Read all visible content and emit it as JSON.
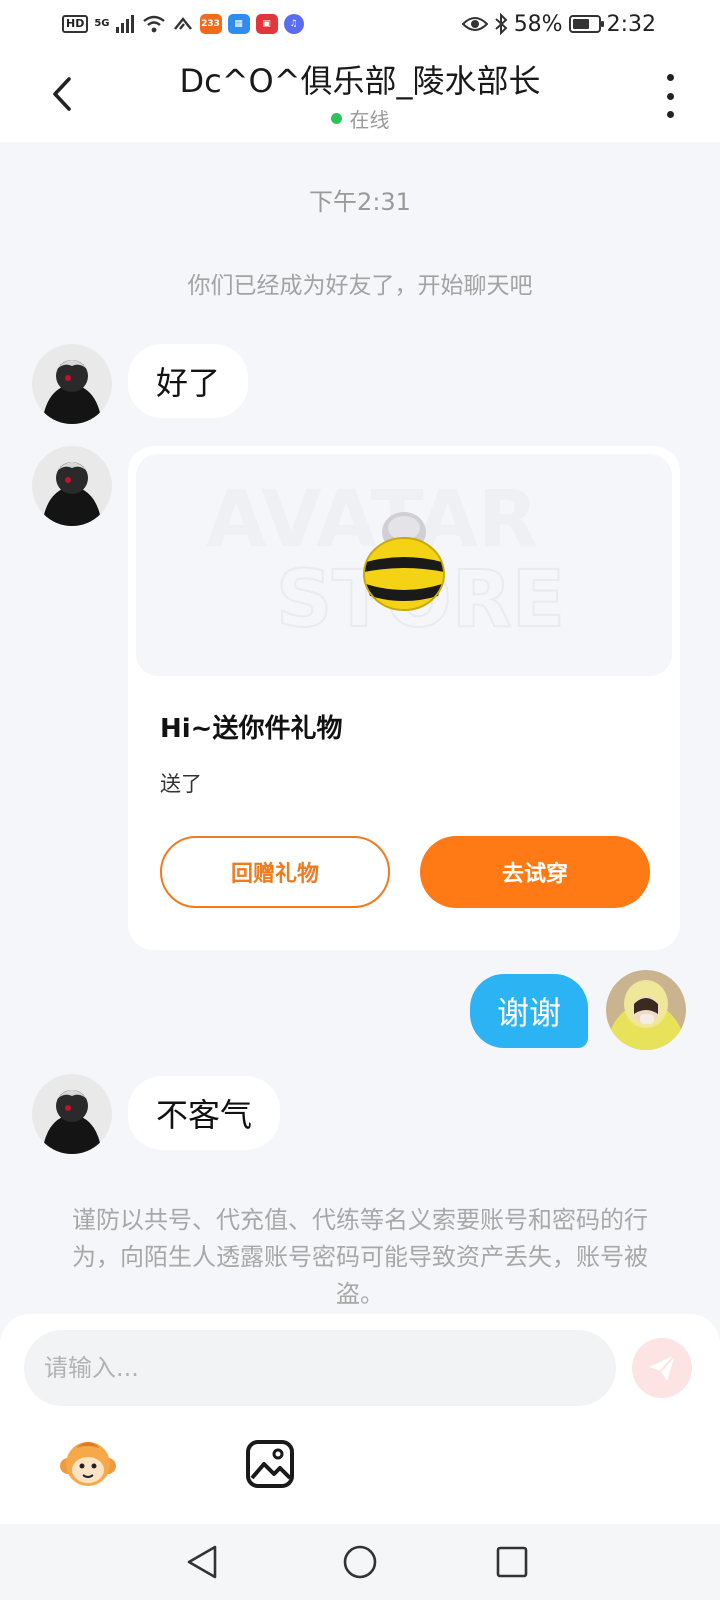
{
  "status_bar": {
    "hd": "HD",
    "network": "5G",
    "app_badge_233": "233",
    "battery": "58%",
    "time": "2:32"
  },
  "header": {
    "title": "Dc^O^俱乐部_陵水部长",
    "status": "在线"
  },
  "chat": {
    "timestamp": "下午2:31",
    "system_note": "你们已经成为好友了，开始聊天吧",
    "messages": [
      {
        "from": "them",
        "text": "好了"
      },
      {
        "from": "them",
        "type": "gift"
      },
      {
        "from": "me",
        "text": "谢谢"
      },
      {
        "from": "them",
        "text": "不客气"
      }
    ],
    "gift": {
      "watermark_line1": "AVATAR",
      "watermark_line2": "STORE",
      "title": "Hi~送你件礼物",
      "subtitle": "送了",
      "return_button": "回赠礼物",
      "try_button": "去试穿"
    },
    "warning": "谨防以共号、代充值、代练等名义索要账号和密码的行为，向陌生人透露账号密码可能导致资产丢失，账号被盗。"
  },
  "input": {
    "placeholder": "请输入..."
  },
  "colors": {
    "accent_orange": "#ff7a14",
    "bubble_blue": "#2bb3f4",
    "online_green": "#2ec25b",
    "background": "#f4f6f9"
  },
  "icons": {
    "back": "chevron-left-icon",
    "more": "more-vertical-icon",
    "send": "send-icon",
    "emoji": "monkey-emoji-icon",
    "image": "image-icon"
  }
}
